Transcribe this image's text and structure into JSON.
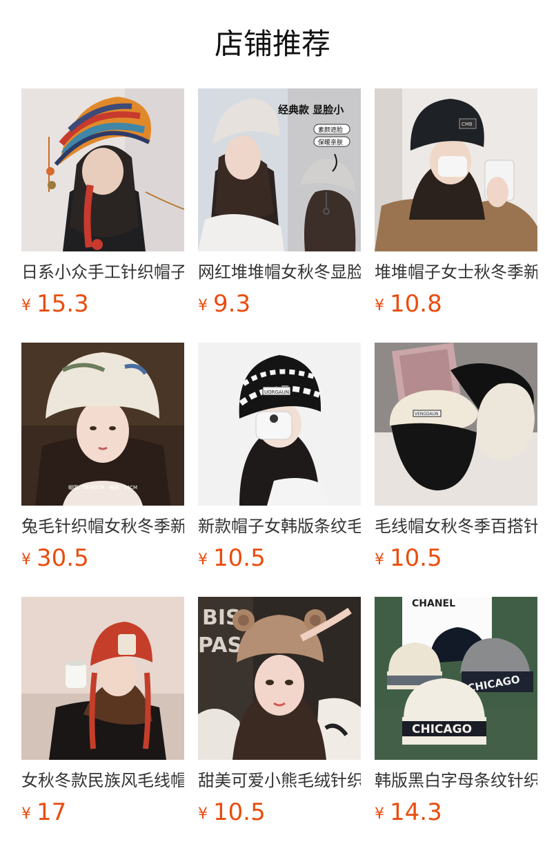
{
  "page_title": "店铺推荐",
  "currency": "¥",
  "products": [
    {
      "name": "日系小众手工针织帽子",
      "price": "15.3",
      "icon": "colorful-knit-hat-image"
    },
    {
      "name": "网红堆堆帽女秋冬显脸小",
      "price": "9.3",
      "icon": "beige-slouchy-beanie-image",
      "overlay": {
        "headline": "经典款 显脸小",
        "tag1": "素颜遮脸",
        "tag2": "保暖亲肤"
      }
    },
    {
      "name": "堆堆帽子女士秋冬季新款",
      "price": "10.8",
      "icon": "black-beanie-image",
      "overlay": {
        "label": "CMB"
      }
    },
    {
      "name": "兔毛针织帽女秋冬季新款",
      "price": "30.5",
      "icon": "white-fur-hat-image",
      "overlay": {
        "size_text": "帽围：56-60CM　帽深：14CM"
      }
    },
    {
      "name": "新款帽子女韩版条纹毛线",
      "price": "10.5",
      "icon": "striped-fuzzy-beanie-image",
      "overlay": {
        "label": "UORGAUN"
      }
    },
    {
      "name": "毛线帽女秋冬季百搭针织",
      "price": "10.5",
      "icon": "two-fuzzy-beanies-image",
      "overlay": {
        "label": "VENGDAUN"
      }
    },
    {
      "name": "女秋冬款民族风毛线帽子",
      "price": "17",
      "icon": "red-knit-hat-image"
    },
    {
      "name": "甜美可爱小熊毛绒针织帽",
      "price": "10.5",
      "icon": "bear-ear-hat-image",
      "overlay": {
        "bg_text1": "BIS",
        "bg_text2": "PAS"
      }
    },
    {
      "name": "韩版黑白字母条纹针织帽",
      "price": "14.3",
      "icon": "chicago-beanies-image",
      "overlay": {
        "brand": "CHANEL",
        "word": "CHICAGO"
      }
    }
  ],
  "colors": {
    "price": "#ea4c0e",
    "title": "#111111",
    "name": "#333333"
  }
}
